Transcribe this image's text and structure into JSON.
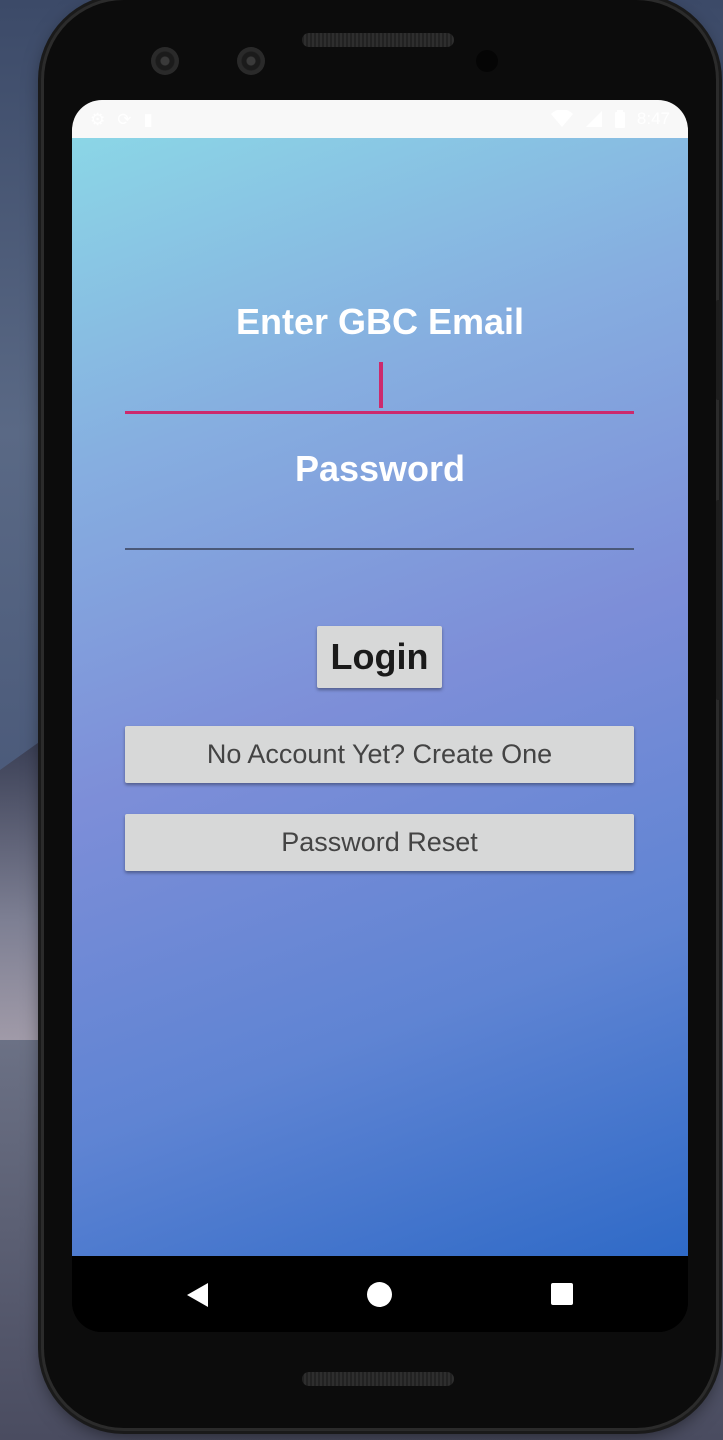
{
  "status_bar": {
    "left_icons": [
      "settings-icon",
      "sync-icon",
      "sd-card-icon"
    ],
    "right_icons": [
      "wifi-icon",
      "signal-icon",
      "battery-icon"
    ],
    "time": "8:47"
  },
  "form": {
    "email_label": "Enter GBC Email",
    "email_value": "",
    "password_label": "Password",
    "password_value": "",
    "login_button": "Login",
    "create_account_button": "No Account Yet? Create One",
    "password_reset_button": "Password Reset"
  },
  "nav_bar": [
    "back-icon",
    "home-icon",
    "recents-icon"
  ],
  "colors": {
    "accent": "#cc2a6d",
    "button_bg": "#d7d8d8",
    "gradient_top": "#8bd6e6",
    "gradient_bottom": "#2f6ac7"
  }
}
